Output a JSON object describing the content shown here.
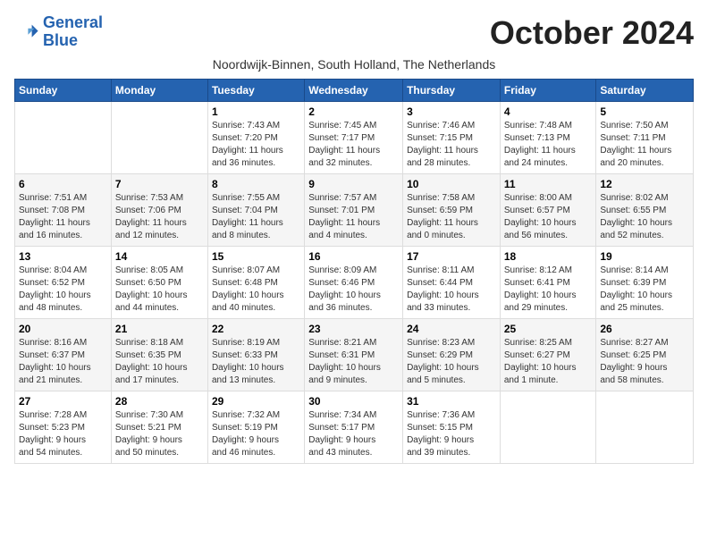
{
  "logo": {
    "line1": "General",
    "line2": "Blue"
  },
  "title": "October 2024",
  "subtitle": "Noordwijk-Binnen, South Holland, The Netherlands",
  "days_of_week": [
    "Sunday",
    "Monday",
    "Tuesday",
    "Wednesday",
    "Thursday",
    "Friday",
    "Saturday"
  ],
  "weeks": [
    [
      {
        "day": "",
        "info": ""
      },
      {
        "day": "",
        "info": ""
      },
      {
        "day": "1",
        "info": "Sunrise: 7:43 AM\nSunset: 7:20 PM\nDaylight: 11 hours\nand 36 minutes."
      },
      {
        "day": "2",
        "info": "Sunrise: 7:45 AM\nSunset: 7:17 PM\nDaylight: 11 hours\nand 32 minutes."
      },
      {
        "day": "3",
        "info": "Sunrise: 7:46 AM\nSunset: 7:15 PM\nDaylight: 11 hours\nand 28 minutes."
      },
      {
        "day": "4",
        "info": "Sunrise: 7:48 AM\nSunset: 7:13 PM\nDaylight: 11 hours\nand 24 minutes."
      },
      {
        "day": "5",
        "info": "Sunrise: 7:50 AM\nSunset: 7:11 PM\nDaylight: 11 hours\nand 20 minutes."
      }
    ],
    [
      {
        "day": "6",
        "info": "Sunrise: 7:51 AM\nSunset: 7:08 PM\nDaylight: 11 hours\nand 16 minutes."
      },
      {
        "day": "7",
        "info": "Sunrise: 7:53 AM\nSunset: 7:06 PM\nDaylight: 11 hours\nand 12 minutes."
      },
      {
        "day": "8",
        "info": "Sunrise: 7:55 AM\nSunset: 7:04 PM\nDaylight: 11 hours\nand 8 minutes."
      },
      {
        "day": "9",
        "info": "Sunrise: 7:57 AM\nSunset: 7:01 PM\nDaylight: 11 hours\nand 4 minutes."
      },
      {
        "day": "10",
        "info": "Sunrise: 7:58 AM\nSunset: 6:59 PM\nDaylight: 11 hours\nand 0 minutes."
      },
      {
        "day": "11",
        "info": "Sunrise: 8:00 AM\nSunset: 6:57 PM\nDaylight: 10 hours\nand 56 minutes."
      },
      {
        "day": "12",
        "info": "Sunrise: 8:02 AM\nSunset: 6:55 PM\nDaylight: 10 hours\nand 52 minutes."
      }
    ],
    [
      {
        "day": "13",
        "info": "Sunrise: 8:04 AM\nSunset: 6:52 PM\nDaylight: 10 hours\nand 48 minutes."
      },
      {
        "day": "14",
        "info": "Sunrise: 8:05 AM\nSunset: 6:50 PM\nDaylight: 10 hours\nand 44 minutes."
      },
      {
        "day": "15",
        "info": "Sunrise: 8:07 AM\nSunset: 6:48 PM\nDaylight: 10 hours\nand 40 minutes."
      },
      {
        "day": "16",
        "info": "Sunrise: 8:09 AM\nSunset: 6:46 PM\nDaylight: 10 hours\nand 36 minutes."
      },
      {
        "day": "17",
        "info": "Sunrise: 8:11 AM\nSunset: 6:44 PM\nDaylight: 10 hours\nand 33 minutes."
      },
      {
        "day": "18",
        "info": "Sunrise: 8:12 AM\nSunset: 6:41 PM\nDaylight: 10 hours\nand 29 minutes."
      },
      {
        "day": "19",
        "info": "Sunrise: 8:14 AM\nSunset: 6:39 PM\nDaylight: 10 hours\nand 25 minutes."
      }
    ],
    [
      {
        "day": "20",
        "info": "Sunrise: 8:16 AM\nSunset: 6:37 PM\nDaylight: 10 hours\nand 21 minutes."
      },
      {
        "day": "21",
        "info": "Sunrise: 8:18 AM\nSunset: 6:35 PM\nDaylight: 10 hours\nand 17 minutes."
      },
      {
        "day": "22",
        "info": "Sunrise: 8:19 AM\nSunset: 6:33 PM\nDaylight: 10 hours\nand 13 minutes."
      },
      {
        "day": "23",
        "info": "Sunrise: 8:21 AM\nSunset: 6:31 PM\nDaylight: 10 hours\nand 9 minutes."
      },
      {
        "day": "24",
        "info": "Sunrise: 8:23 AM\nSunset: 6:29 PM\nDaylight: 10 hours\nand 5 minutes."
      },
      {
        "day": "25",
        "info": "Sunrise: 8:25 AM\nSunset: 6:27 PM\nDaylight: 10 hours\nand 1 minute."
      },
      {
        "day": "26",
        "info": "Sunrise: 8:27 AM\nSunset: 6:25 PM\nDaylight: 9 hours\nand 58 minutes."
      }
    ],
    [
      {
        "day": "27",
        "info": "Sunrise: 7:28 AM\nSunset: 5:23 PM\nDaylight: 9 hours\nand 54 minutes."
      },
      {
        "day": "28",
        "info": "Sunrise: 7:30 AM\nSunset: 5:21 PM\nDaylight: 9 hours\nand 50 minutes."
      },
      {
        "day": "29",
        "info": "Sunrise: 7:32 AM\nSunset: 5:19 PM\nDaylight: 9 hours\nand 46 minutes."
      },
      {
        "day": "30",
        "info": "Sunrise: 7:34 AM\nSunset: 5:17 PM\nDaylight: 9 hours\nand 43 minutes."
      },
      {
        "day": "31",
        "info": "Sunrise: 7:36 AM\nSunset: 5:15 PM\nDaylight: 9 hours\nand 39 minutes."
      },
      {
        "day": "",
        "info": ""
      },
      {
        "day": "",
        "info": ""
      }
    ]
  ]
}
